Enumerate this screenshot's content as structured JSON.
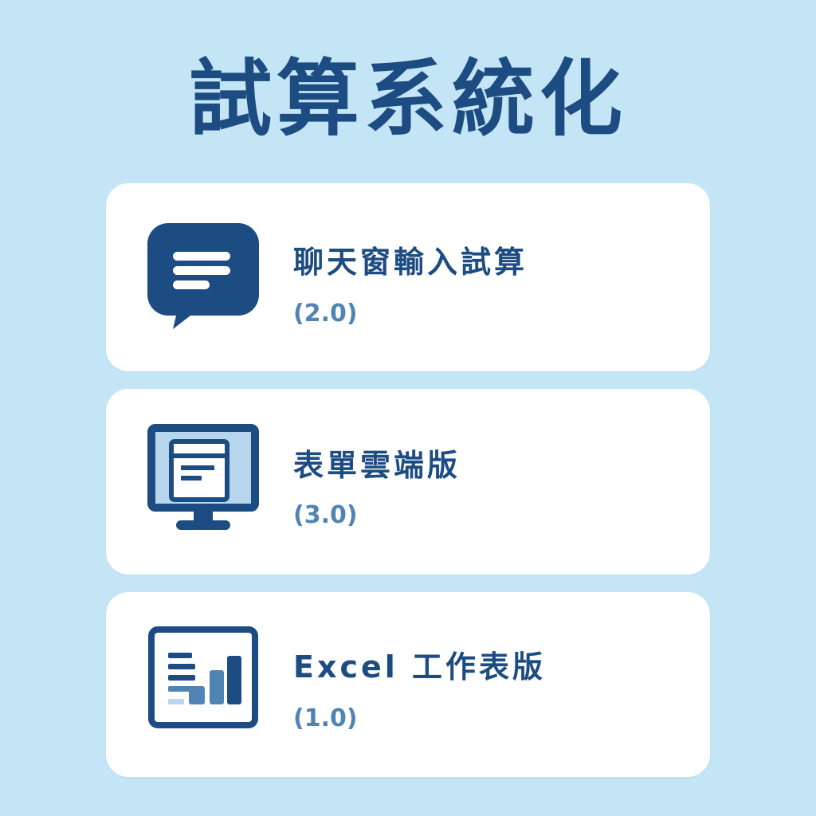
{
  "title": "試算系統化",
  "colors": {
    "background": "#c4e5f5",
    "primary": "#1d4c82",
    "secondary": "#4f84b4",
    "light_accent": "#b7d6ee",
    "card": "#ffffff"
  },
  "cards": [
    {
      "icon": "chat-bubble-icon",
      "title": "聊天窗輸入試算",
      "version": "(2.0)"
    },
    {
      "icon": "monitor-form-icon",
      "title": "表單雲端版",
      "version": "(3.0)"
    },
    {
      "icon": "spreadsheet-chart-icon",
      "title": "Excel 工作表版",
      "version": "(1.0)"
    }
  ]
}
